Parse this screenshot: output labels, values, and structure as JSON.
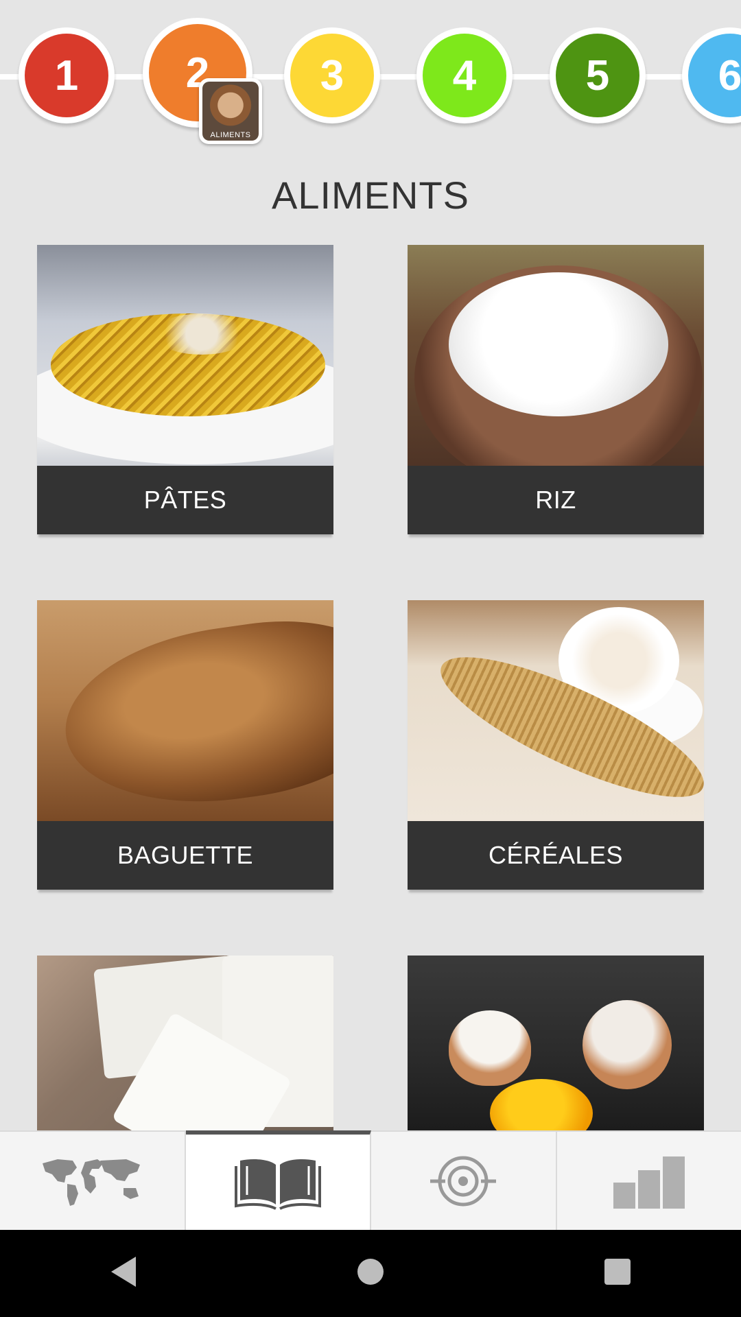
{
  "levels": [
    {
      "number": "1",
      "color": "#d93a2b"
    },
    {
      "number": "2",
      "color": "#ef7d2c"
    },
    {
      "number": "3",
      "color": "#fdd835"
    },
    {
      "number": "4",
      "color": "#7ee81b"
    },
    {
      "number": "5",
      "color": "#4e9412"
    },
    {
      "number": "6",
      "color": "#4fb9f0"
    }
  ],
  "current_level_badge": {
    "label": "ALIMENTS"
  },
  "page_title": "ALIMENTS",
  "cards": [
    {
      "label": "PÂTES"
    },
    {
      "label": "RIZ"
    },
    {
      "label": "BAGUETTE"
    },
    {
      "label": "CÉRÉALES"
    },
    {
      "label": ""
    },
    {
      "label": ""
    }
  ],
  "tabs": [
    {
      "icon": "world-map-icon"
    },
    {
      "icon": "open-book-icon",
      "active": true
    },
    {
      "icon": "target-icon"
    },
    {
      "icon": "bar-chart-icon"
    }
  ],
  "system_nav": {
    "back_icon": "back-triangle-icon",
    "home_icon": "home-circle-icon",
    "recents_icon": "recents-square-icon"
  }
}
